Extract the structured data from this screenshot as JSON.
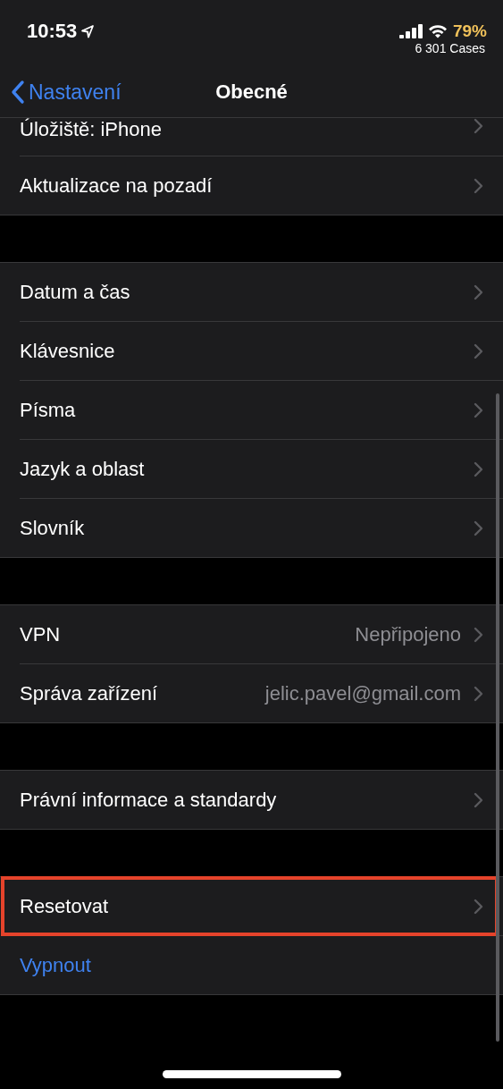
{
  "status_bar": {
    "time": "10:53",
    "battery": "79%",
    "subtitle": "6 301 Cases"
  },
  "nav": {
    "back": "Nastavení",
    "title": "Obecné"
  },
  "groups": [
    {
      "rows": [
        {
          "kind": "link",
          "label": "Úložiště: iPhone",
          "highlighted": false
        },
        {
          "kind": "link",
          "label": "Aktualizace na pozadí",
          "highlighted": false
        }
      ]
    },
    {
      "rows": [
        {
          "kind": "link",
          "label": "Datum a čas",
          "highlighted": false
        },
        {
          "kind": "link",
          "label": "Klávesnice",
          "highlighted": false
        },
        {
          "kind": "link",
          "label": "Písma",
          "highlighted": false
        },
        {
          "kind": "link",
          "label": "Jazyk a oblast",
          "highlighted": false
        },
        {
          "kind": "link",
          "label": "Slovník",
          "highlighted": false
        }
      ]
    },
    {
      "rows": [
        {
          "kind": "link",
          "label": "VPN",
          "value": "Nepřipojeno",
          "highlighted": false
        },
        {
          "kind": "link",
          "label": "Správa zařízení",
          "value": "jelic.pavel@gmail.com",
          "highlighted": false
        }
      ]
    },
    {
      "rows": [
        {
          "kind": "link",
          "label": "Právní informace a standardy",
          "highlighted": false
        }
      ]
    },
    {
      "rows": [
        {
          "kind": "link",
          "label": "Resetovat",
          "highlighted": true
        },
        {
          "kind": "action",
          "label": "Vypnout",
          "highlighted": false
        }
      ]
    }
  ]
}
